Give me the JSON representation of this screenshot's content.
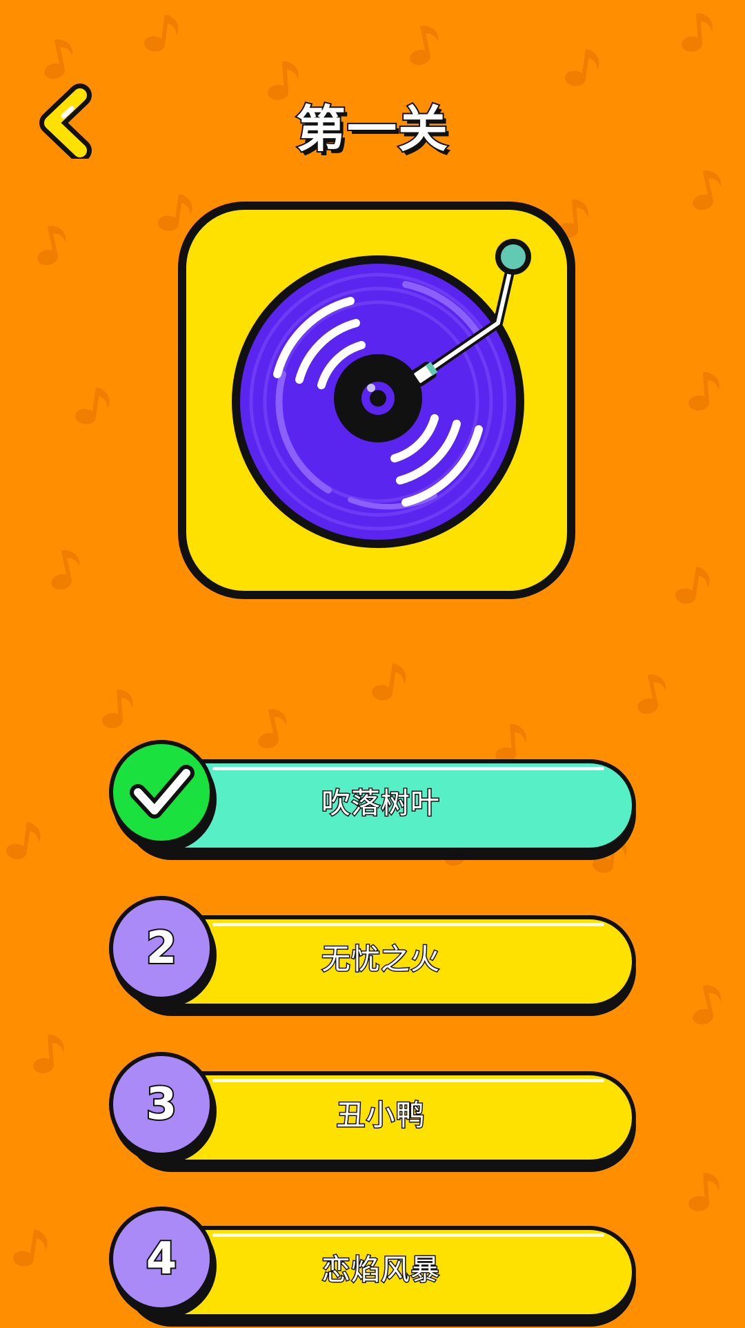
{
  "header": {
    "title": "第一关",
    "back_icon": "chevron-left-icon"
  },
  "colors": {
    "background": "#FF8F00",
    "card": "#FFE100",
    "disc": "#5B25F0",
    "correct_option": "#57EFC6",
    "correct_badge": "#1BE13E",
    "option_badge": "#A98AF7"
  },
  "options": [
    {
      "badge": "",
      "badge_icon": "check-icon",
      "label": "吹落树叶",
      "state": "correct"
    },
    {
      "badge": "2",
      "label": "无忧之火",
      "state": "default"
    },
    {
      "badge": "3",
      "label": "丑小鸭",
      "state": "default"
    },
    {
      "badge": "4",
      "label": "恋焰风暴",
      "state": "default"
    }
  ]
}
